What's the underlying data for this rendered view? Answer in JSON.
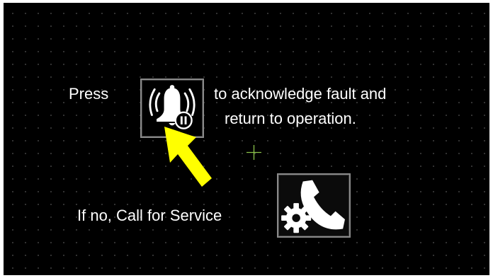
{
  "instructions": {
    "press_label": "Press",
    "acknowledge_line1": "to acknowledge fault and",
    "acknowledge_line2": "return to operation."
  },
  "service": {
    "label": "If no, Call for Service"
  },
  "icons": {
    "acknowledge": "bell-pause-icon",
    "service": "phone-gear-icon",
    "pointer": "yellow-arrow-icon",
    "crosshair": "crosshair-icon"
  },
  "colors": {
    "background": "#000000",
    "text": "#ffffff",
    "arrow": "#ffff00",
    "crosshair": "#8bc34a",
    "button_border": "#8a8a8a"
  }
}
